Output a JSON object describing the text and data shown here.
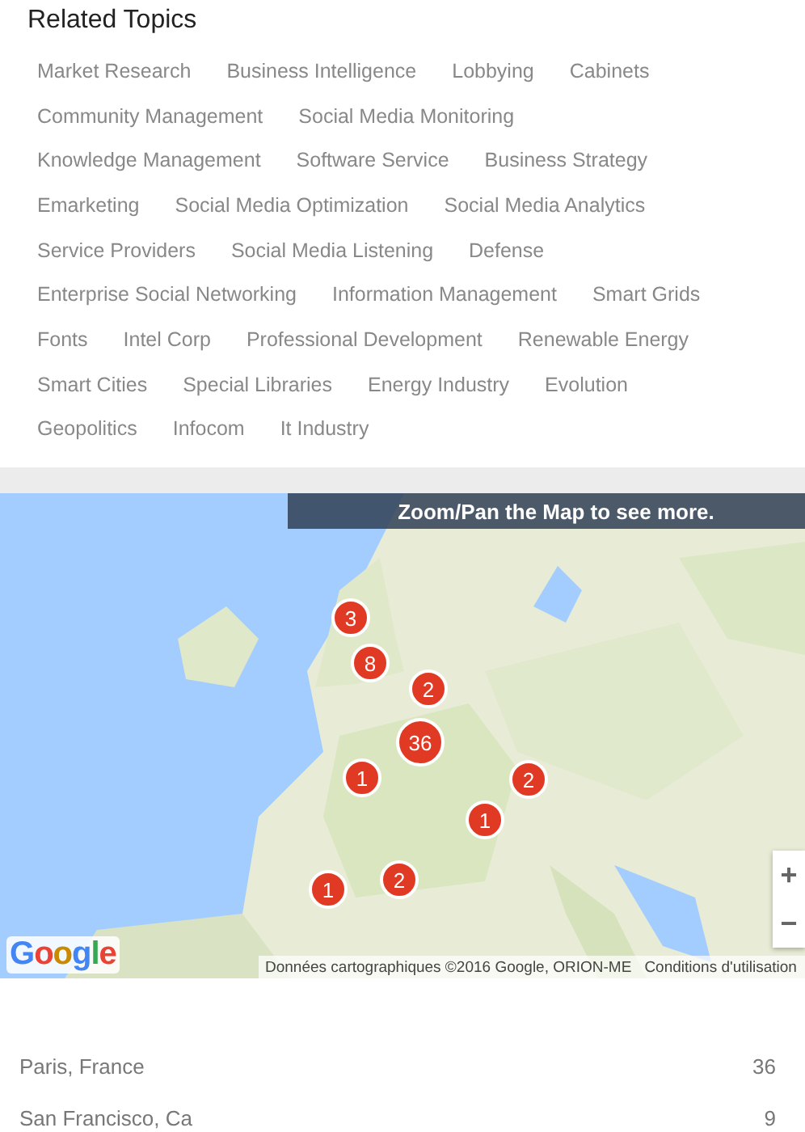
{
  "related_topics": {
    "title": "Related Topics",
    "rows": [
      [
        "Market Research",
        "Business Intelligence",
        "Lobbying",
        "Cabinets"
      ],
      [
        "Community Management",
        "Social Media Monitoring"
      ],
      [
        "Knowledge Management",
        "Software Service",
        "Business Strategy"
      ],
      [
        "Emarketing",
        "Social Media Optimization",
        "Social Media Analytics"
      ],
      [
        "Service Providers",
        "Social Media Listening",
        "Defense"
      ],
      [
        "Enterprise Social Networking",
        "Information Management",
        "Smart Grids"
      ],
      [
        "Fonts",
        "Intel Corp",
        "Professional Development",
        "Renewable Energy"
      ],
      [
        "Smart Cities",
        "Special Libraries",
        "Energy Industry",
        "Evolution"
      ],
      [
        "Geopolitics",
        "Infocom",
        "It Industry"
      ]
    ]
  },
  "map": {
    "banner": "Zoom/Pan the Map to see more.",
    "markers": [
      "3",
      "8",
      "2",
      "36",
      "1",
      "2",
      "1",
      "1",
      "2"
    ],
    "logo": "Google",
    "attribution": "Données cartographiques ©2016 Google, ORION-ME",
    "terms": "Conditions d'utilisation",
    "zoom_in": "+",
    "zoom_out": "−"
  },
  "locations": [
    {
      "name": "Paris, France",
      "count": "36"
    },
    {
      "name": "San Francisco, Ca",
      "count": "9"
    }
  ]
}
